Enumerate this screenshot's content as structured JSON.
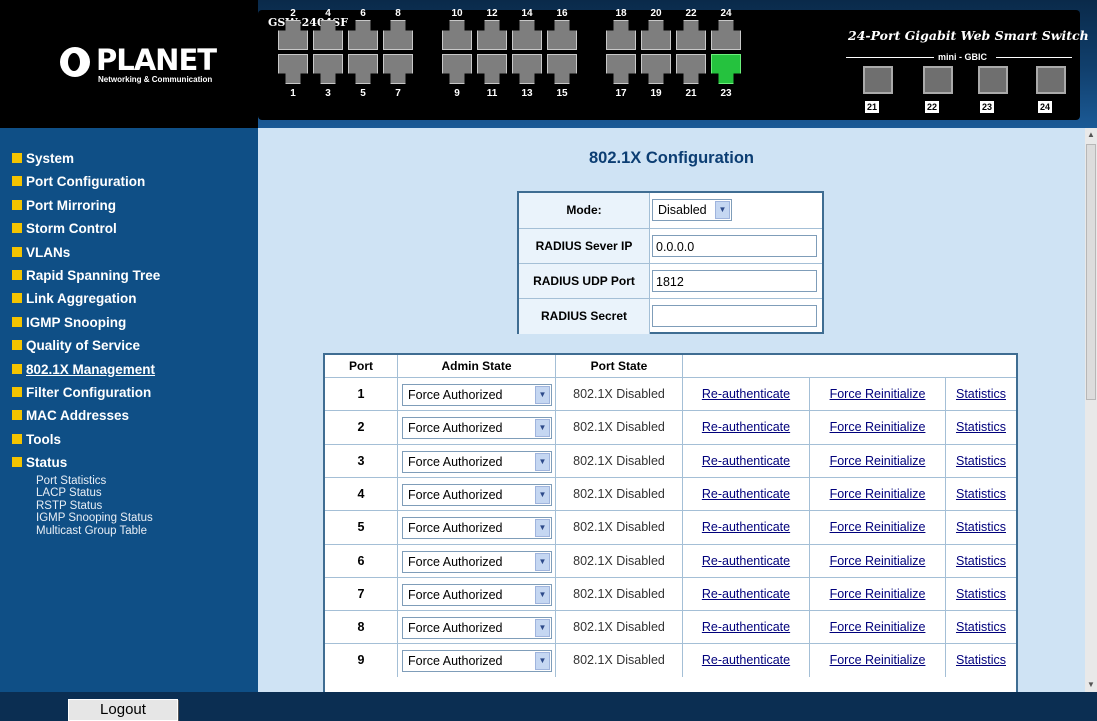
{
  "header": {
    "logo_text": "PLANET",
    "logo_tagline": "Networking & Communication",
    "model": "GSW-2404SF",
    "product_title": "24-Port Gigabit Web Smart Switch",
    "mini_gbic_label": "mini - GBIC",
    "top_port_numbers": [
      "2",
      "4",
      "6",
      "8",
      "10",
      "12",
      "14",
      "16",
      "18",
      "20",
      "22",
      "24"
    ],
    "bottom_port_numbers": [
      "1",
      "3",
      "5",
      "7",
      "9",
      "11",
      "13",
      "15",
      "17",
      "19",
      "21",
      "23"
    ],
    "active_ports": [
      "23"
    ],
    "sfp_ports": [
      "21",
      "22",
      "23",
      "24"
    ],
    "colors": {
      "port_active": "#25c23e",
      "port_idle": "#7e7e7e"
    }
  },
  "sidebar": {
    "items": [
      {
        "label": "System"
      },
      {
        "label": "Port Configuration"
      },
      {
        "label": "Port Mirroring"
      },
      {
        "label": "Storm Control"
      },
      {
        "label": "VLANs"
      },
      {
        "label": "Rapid Spanning Tree"
      },
      {
        "label": "Link Aggregation"
      },
      {
        "label": "IGMP Snooping"
      },
      {
        "label": "Quality of Service"
      },
      {
        "label": "802.1X Management"
      },
      {
        "label": "Filter Configuration"
      },
      {
        "label": "MAC Addresses"
      },
      {
        "label": "Tools"
      },
      {
        "label": "Status"
      }
    ],
    "current_item": "802.1X Management",
    "status_subitems": [
      "Port Statistics",
      "LACP Status",
      "RSTP Status",
      "IGMP Snooping Status",
      "Multicast Group Table"
    ],
    "logout_label": "Logout",
    "bullet_color": "#f3c300"
  },
  "main": {
    "title": "802.1X Configuration",
    "config": {
      "mode_label": "Mode:",
      "mode_value": "Disabled",
      "radius_ip_label": "RADIUS Sever IP",
      "radius_ip_value": "0.0.0.0",
      "radius_port_label": "RADIUS UDP Port",
      "radius_port_value": "1812",
      "radius_secret_label": "RADIUS Secret",
      "radius_secret_value": ""
    },
    "table": {
      "headers": [
        "Port",
        "Admin State",
        "Port State",
        ""
      ],
      "rows": [
        {
          "port": "1",
          "admin_state": "Force Authorized",
          "port_state": "802.1X Disabled",
          "reauth": "Re-authenticate",
          "reinit": "Force Reinitialize",
          "stats": "Statistics"
        },
        {
          "port": "2",
          "admin_state": "Force Authorized",
          "port_state": "802.1X Disabled",
          "reauth": "Re-authenticate",
          "reinit": "Force Reinitialize",
          "stats": "Statistics"
        },
        {
          "port": "3",
          "admin_state": "Force Authorized",
          "port_state": "802.1X Disabled",
          "reauth": "Re-authenticate",
          "reinit": "Force Reinitialize",
          "stats": "Statistics"
        },
        {
          "port": "4",
          "admin_state": "Force Authorized",
          "port_state": "802.1X Disabled",
          "reauth": "Re-authenticate",
          "reinit": "Force Reinitialize",
          "stats": "Statistics"
        },
        {
          "port": "5",
          "admin_state": "Force Authorized",
          "port_state": "802.1X Disabled",
          "reauth": "Re-authenticate",
          "reinit": "Force Reinitialize",
          "stats": "Statistics"
        },
        {
          "port": "6",
          "admin_state": "Force Authorized",
          "port_state": "802.1X Disabled",
          "reauth": "Re-authenticate",
          "reinit": "Force Reinitialize",
          "stats": "Statistics"
        },
        {
          "port": "7",
          "admin_state": "Force Authorized",
          "port_state": "802.1X Disabled",
          "reauth": "Re-authenticate",
          "reinit": "Force Reinitialize",
          "stats": "Statistics"
        },
        {
          "port": "8",
          "admin_state": "Force Authorized",
          "port_state": "802.1X Disabled",
          "reauth": "Re-authenticate",
          "reinit": "Force Reinitialize",
          "stats": "Statistics"
        },
        {
          "port": "9",
          "admin_state": "Force Authorized",
          "port_state": "802.1X Disabled",
          "reauth": "Re-authenticate",
          "reinit": "Force Reinitialize",
          "stats": "Statistics"
        }
      ]
    }
  }
}
